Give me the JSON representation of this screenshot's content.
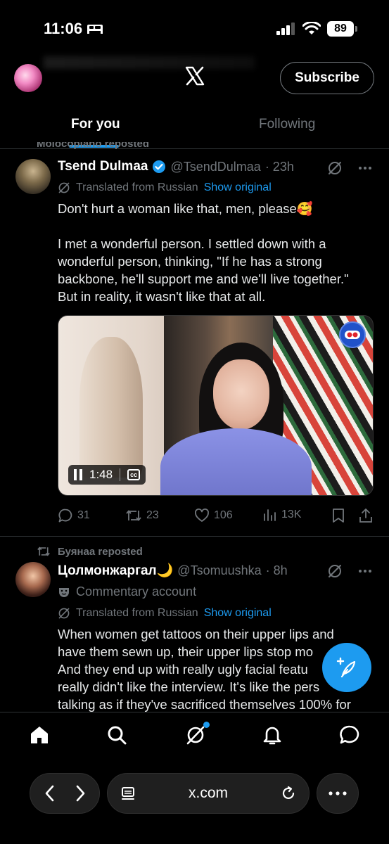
{
  "status_bar": {
    "time": "11:06",
    "battery": "89"
  },
  "header": {
    "logo": "x-logo",
    "subscribe_label": "Subscribe"
  },
  "tabs": [
    {
      "label": "For you",
      "active": true
    },
    {
      "label": "Following",
      "active": false
    }
  ],
  "cut_repost_text": "Molocopiano reposted",
  "tweets": [
    {
      "name": "Tsend Dulmaa",
      "verified": true,
      "handle": "@TsendDulmaa",
      "time": "· 23h",
      "translated_label": "Translated from Russian",
      "show_original_label": "Show original",
      "paragraphs": [
        "Don't hurt a woman like that, men, please🥰",
        "I met a wonderful person. I settled down with a wonderful person, thinking, \"If he has a strong backbone, he'll support me and we'll live together.\" But in reality, it wasn't like that at all."
      ],
      "video": {
        "duration": "1:48",
        "cc_label": "cc"
      },
      "stats": {
        "replies": "31",
        "reposts": "23",
        "likes": "106",
        "views": "13K"
      }
    },
    {
      "reposted_by": "Буянаа reposted",
      "name": "Цолмонжаргал🌙",
      "handle": "@Tsomuushka",
      "time": "· 8h",
      "commentary_label": "Commentary account",
      "translated_label": "Translated from Russian",
      "show_original_label": "Show original",
      "text_lines": [
        "When women get tattoos on their upper lips and",
        "have them sewn up, their upper lips stop mo",
        "And they end up with really ugly facial featu",
        "really didn't like the interview. It's like the pers",
        "talking as if they've sacrificed themselves 100% for"
      ]
    }
  ],
  "browser": {
    "url": "x.com"
  },
  "colors": {
    "accent": "#1d9bf0",
    "muted": "#71767b",
    "background": "#000000"
  }
}
